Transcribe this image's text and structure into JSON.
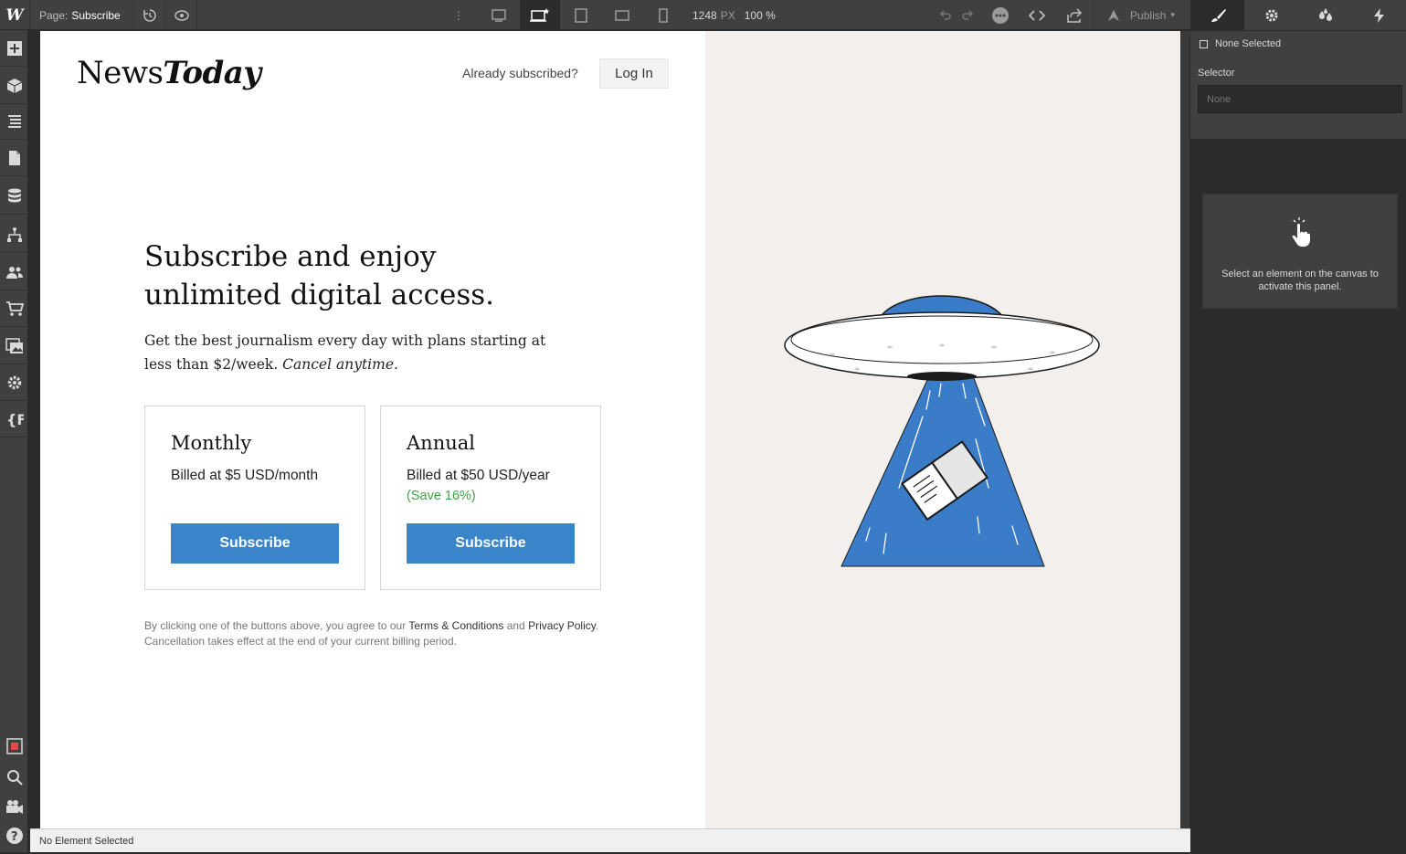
{
  "toolbar": {
    "page_label": "Page:",
    "page_name": "Subscribe",
    "width_value": "1248",
    "width_unit": "PX",
    "zoom": "100 %",
    "publish_label": "Publish"
  },
  "right_tabs": [
    "style-brush",
    "settings-gear",
    "interactions-drops",
    "lightning"
  ],
  "left_tools": [
    "add",
    "navigator-box",
    "layers",
    "pages",
    "cms",
    "logic",
    "users",
    "ecommerce",
    "assets",
    "settings",
    "fonts"
  ],
  "canvas": {
    "logo_regular": "News",
    "logo_italic": "Today",
    "already_text": "Already subscribed?",
    "login_label": "Log In",
    "headline": "Subscribe and enjoy unlimited digital access.",
    "subhead_main": "Get the best journalism every day with plans starting at less than $2/week.",
    "subhead_italic": "Cancel anytime.",
    "plans": [
      {
        "title": "Monthly",
        "price": "Billed at $5 USD/month",
        "save": "",
        "button": "Subscribe"
      },
      {
        "title": "Annual",
        "price": "Billed at $50 USD/year",
        "save": "(Save 16%)",
        "button": "Subscribe"
      }
    ],
    "legal_pre": "By clicking one of the buttons above, you agree to our",
    "legal_terms": "Terms & Conditions",
    "legal_and": "and",
    "legal_privacy": "Privacy Policy",
    "legal_post": ". Cancellation takes effect at the end of your current billing period."
  },
  "panel": {
    "none_selected": "None Selected",
    "selector_label": "Selector",
    "selector_placeholder": "None",
    "hint": "Select an element on the canvas to activate this panel."
  },
  "statusbar": {
    "text": "No Element Selected"
  },
  "colors": {
    "accent": "#3a84c9",
    "save_green": "#41a347",
    "ufo_blue": "#3a7cc7",
    "panel_bg": "#2b2b2b"
  }
}
